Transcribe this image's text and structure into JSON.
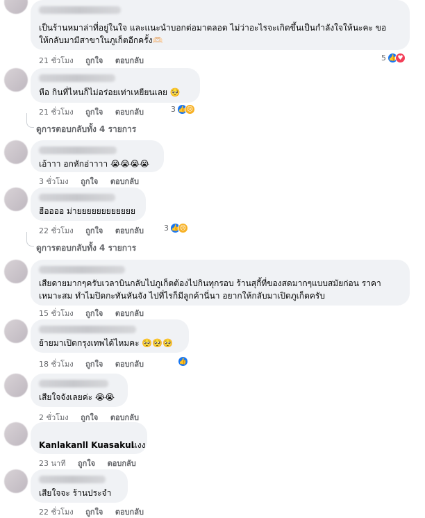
{
  "comments": [
    {
      "text1": "เป็นร้านหมาล่าที่อยู่ในใจ และแนะนำบอกต่อมาตลอด ไม่ว่าอะไรจะเกิดขึ้นเป็นกำลังใจให้นะคะ ขอ",
      "text2": "ให้กลับมามีสาขาในภูเก็ตอีกครั้ง🫶🏻",
      "time": "21 ชั่วโมง",
      "like": "ถูกใจ",
      "reply": "ตอบกลับ",
      "react_count": "5"
    },
    {
      "text1": "หือ กินที่ไหนก็ไม่อร่อยเท่าเหยียนเลย 🥺",
      "time": "21 ชั่วโมง",
      "like": "ถูกใจ",
      "reply": "ตอบกลับ",
      "react_count": "3"
    },
    {
      "text1": "เอ้าาา อกหักอ่าาาา 😭😭😭😭",
      "time": "3 ชั่วโมง",
      "like": "ถูกใจ",
      "reply": "ตอบกลับ"
    },
    {
      "text1": "ฮืออออ ม่ายยยยยยยยยยยย",
      "time": "22 ชั่วโมง",
      "like": "ถูกใจ",
      "reply": "ตอบกลับ",
      "react_count": "3"
    },
    {
      "text1": "เสียดายมากๆครับเวลาบินกลับไปภูเก็ตต้องไปกินทุกรอบ ร้านสุกี้ที่ของสดมากๆแบบสมัยก่อน ราคา",
      "text2": "เหมาะสม ทำไมปิดกะทันหันจัง ไปที่ไรก็มีลูกค้านี่นา อยากให้กลับมาเปิดภูเก็ตครับ",
      "time": "15 ชั่วโมง",
      "like": "ถูกใจ",
      "reply": "ตอบกลับ"
    },
    {
      "text1": "ย้ายมาเปิดกรุงเทพได้ไหมคะ 🥺🥺🥺",
      "time": "18 ชั่วโมง",
      "like": "ถูกใจ",
      "reply": "ตอบกลับ"
    },
    {
      "text1": "เสียใจจังเลยค่ะ 😭😭",
      "time": "2 ชั่วโมง",
      "like": "ถูกใจ",
      "reply": "ตอบกลับ"
    },
    {
      "name": "Kanlakanll Kuasakul",
      "text1": "แงง",
      "time": "23 นาที",
      "like": "ถูกใจ",
      "reply": "ตอบกลับ"
    },
    {
      "text1": "เสียใจจะ ร้านประจำ",
      "time": "22 ชั่วโมง",
      "like": "ถูกใจ",
      "reply": "ตอบกลับ"
    }
  ],
  "view_replies": [
    "ดูการตอบกลับทั้ง 4 รายการ",
    "ดูการตอบกลับทั้ง 4 รายการ"
  ],
  "icons": {
    "like": "like-reaction-icon",
    "love": "love-reaction-icon",
    "sad": "sad-reaction-icon"
  },
  "colors": {
    "bubble": "#f0f2f5",
    "like": "#1877f2",
    "love": "#f33e58",
    "meta": "#65676b"
  }
}
